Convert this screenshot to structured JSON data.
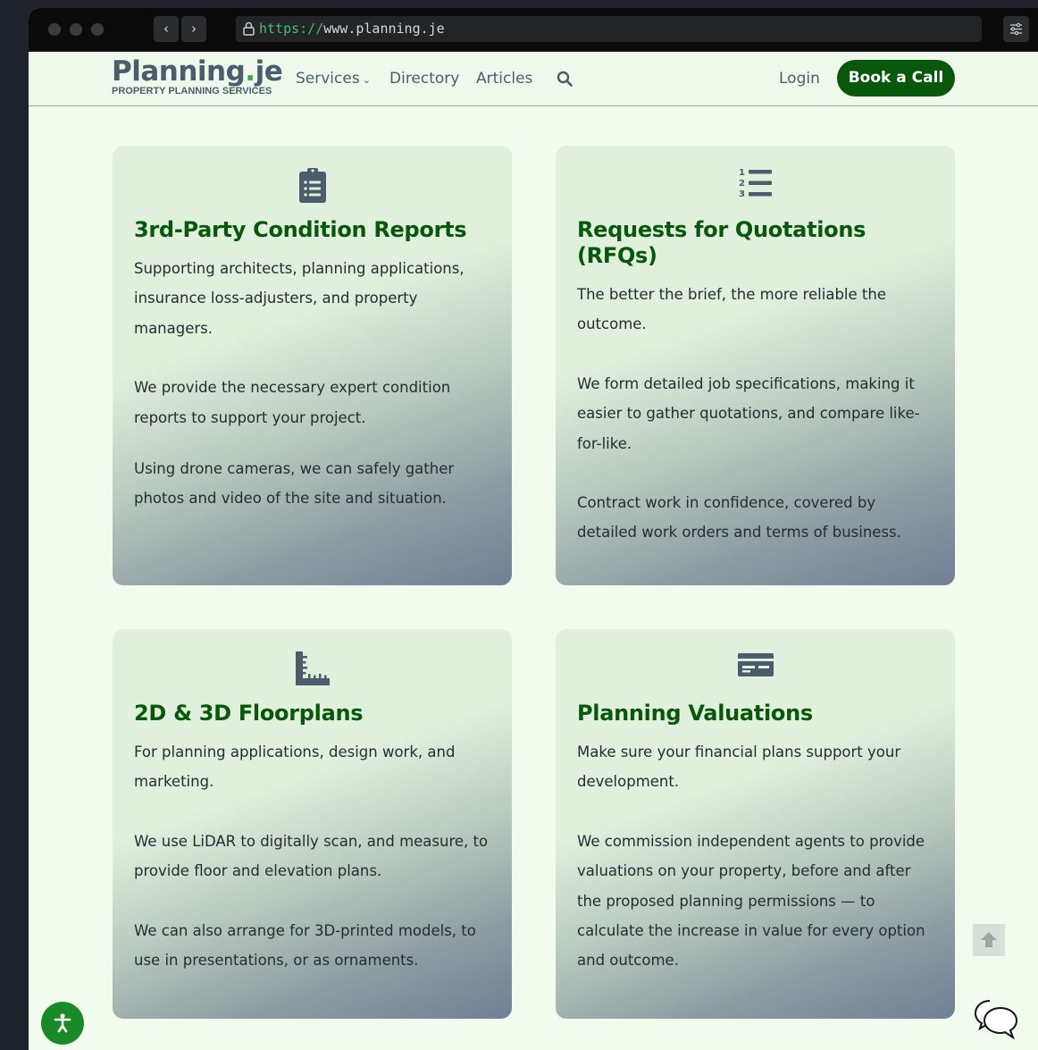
{
  "browser": {
    "url_scheme": "https://",
    "url_host": "www.planning.je",
    "back_label": "‹",
    "forward_label": "›"
  },
  "header": {
    "logo_main": "Planning",
    "logo_dot": ".",
    "logo_tld": "je",
    "logo_tagline": "PROPERTY PLANNING SERVICES",
    "nav": {
      "services": "Services",
      "directory": "Directory",
      "articles": "Articles"
    },
    "login": "Login",
    "cta": "Book a Call"
  },
  "cards": [
    {
      "icon": "clipboard-list-icon",
      "title": "3rd-Party Condition Reports",
      "paragraphs": [
        "Supporting architects, planning applications, insurance loss-adjusters, and property managers.",
        "We provide the necessary expert condition reports to support your project.",
        "Using drone cameras, we can safely gather photos and video of the site and situation."
      ]
    },
    {
      "icon": "numbered-list-icon",
      "title": "Requests for Quotations (RFQs)",
      "paragraphs": [
        "The better the brief, the more reliable the outcome.",
        "We form detailed job specifications, making it easier to gather quotations, and compare like-for-like.",
        "Contract work in confidence, covered by detailed work orders and terms of business."
      ]
    },
    {
      "icon": "ruler-icon",
      "title": "2D & 3D Floorplans",
      "paragraphs": [
        "For planning applications, design work, and marketing.",
        "We use LiDAR to digitally scan, and measure, to provide floor and elevation plans.",
        "We can also arrange for 3D-printed models, to use in presentations, or as ornaments."
      ]
    },
    {
      "icon": "money-check-icon",
      "title": "Planning Valuations",
      "paragraphs": [
        "Make sure your financial plans support your development.",
        "We commission independent agents to provide valuations on your property, before and after the proposed planning permissions — to calculate the increase in value for every option and outcome."
      ]
    }
  ],
  "colors": {
    "brand_green": "#07580b",
    "accent_green": "#3aa94b",
    "slate": "#4c5c6d",
    "page_bg": "#f1fcef"
  }
}
